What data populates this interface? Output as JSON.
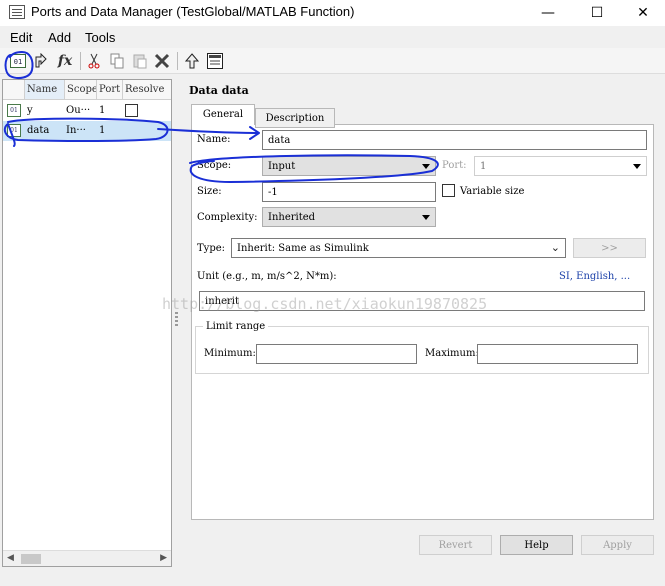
{
  "window": {
    "title": "Ports and Data Manager (TestGlobal/MATLAB Function)",
    "minimize": "—",
    "maximize": "☐",
    "close": "✕"
  },
  "menu": [
    {
      "label": "Edit"
    },
    {
      "label": "Add"
    },
    {
      "label": "Tools"
    }
  ],
  "toolbar": {
    "fx_label": "fx",
    "icons": [
      "add-data-icon",
      "add-input-icon",
      "add-function-icon",
      "cut-icon",
      "copy-icon",
      "paste-icon",
      "delete-icon",
      "move-up-icon",
      "model-explorer-icon"
    ]
  },
  "table": {
    "columns": [
      "Name",
      "Scope",
      "Port",
      "Resolve"
    ],
    "rows": [
      {
        "name": "y",
        "scope": "Ou···",
        "port": "1",
        "has_checkbox": true
      },
      {
        "name": "data",
        "scope": "In···",
        "port": "1",
        "has_checkbox": false,
        "selected": true
      }
    ]
  },
  "details": {
    "title": "Data data",
    "tabs": [
      {
        "label": "General",
        "active": true
      },
      {
        "label": "Description",
        "active": false
      }
    ],
    "name_label": "Name:",
    "name_value": "data",
    "scope_label": "Scope:",
    "scope_value": "Input",
    "port_label": "Port:",
    "port_value": "1",
    "size_label": "Size:",
    "size_value": "-1",
    "variable_size_label": "Variable size",
    "complexity_label": "Complexity:",
    "complexity_value": "Inherited",
    "type_label": "Type:",
    "type_value": "Inherit: Same as Simulink",
    "type_button": ">>",
    "unit_label": "Unit (e.g., m, m/s^2, N*m):",
    "unit_links": "SI, English, ...",
    "unit_value": "inherit",
    "limit_range_label": "Limit range",
    "minimum_label": "Minimum:",
    "minimum_value": "",
    "maximum_label": "Maximum:",
    "maximum_value": ""
  },
  "buttons": {
    "revert": "Revert",
    "help": "Help",
    "apply": "Apply"
  },
  "watermark": "http://blog.csdn.net/xiaokun19870825",
  "colors": {
    "selection": "#cce4f7",
    "annotation": "#1a2fd6",
    "link": "#1a3fa8"
  }
}
